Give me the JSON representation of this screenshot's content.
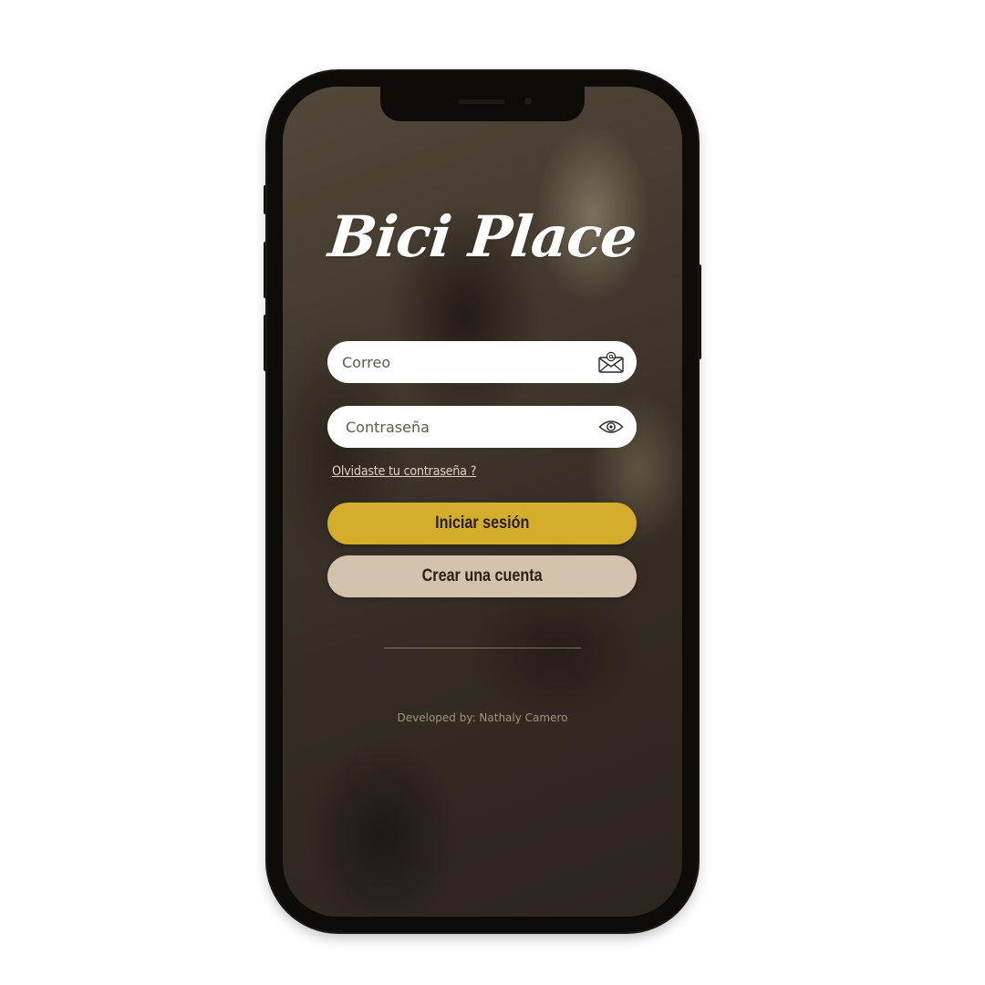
{
  "app": {
    "logo_text": "Bici Place"
  },
  "form": {
    "email_placeholder": "Correo",
    "email_value": "",
    "password_placeholder": "Contraseña",
    "password_value": "",
    "forgot_password_label": "Olvidaste tu contraseña ?",
    "login_label": "Iniciar sesión",
    "create_account_label": "Crear una cuenta"
  },
  "footer": {
    "credit": "Developed by: Nathaly Camero"
  },
  "icons": {
    "email": "envelope-at-icon",
    "password": "eye-icon"
  },
  "colors": {
    "login_button": "#d4ad2b",
    "create_button": "#d3c2ac",
    "button_text": "#2a2116",
    "field_background": "#ffffff"
  }
}
